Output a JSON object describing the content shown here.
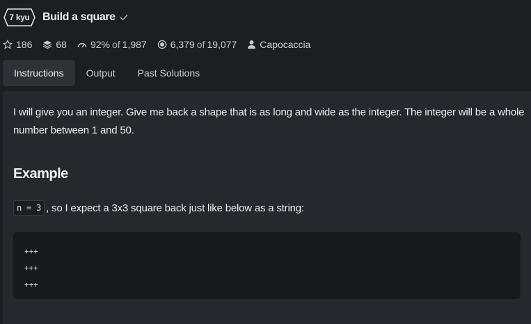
{
  "kata": {
    "rank": "7 kyu",
    "title": "Build a square"
  },
  "stats": {
    "stars": "186",
    "collections": "68",
    "satisfaction_percent": "92%",
    "satisfaction_of": "of",
    "satisfaction_votes": "1,987",
    "completed": "6,379",
    "completed_of": "of",
    "attempted": "19,077",
    "author": "Capocaccia"
  },
  "tabs": [
    {
      "label": "Instructions",
      "active": true
    },
    {
      "label": "Output",
      "active": false
    },
    {
      "label": "Past Solutions",
      "active": false
    }
  ],
  "instructions": {
    "description": "I will give you an integer. Give me back a shape that is as long and wide as the integer. The integer will be a whole number between 1 and 50.",
    "example_heading": "Example",
    "inline_code": "n = 3",
    "inline_text": ", so I expect a 3x3 square back just like below as a string:",
    "code_lines": [
      "+++",
      "+++",
      "+++"
    ]
  },
  "colors": {
    "background": "#1d1e22",
    "panel": "#27282d",
    "active_tab": "#303136",
    "code_block": "#18191c"
  }
}
